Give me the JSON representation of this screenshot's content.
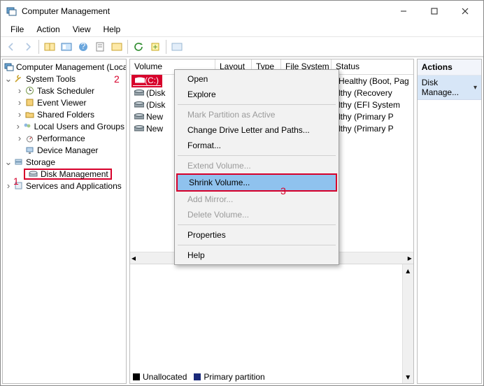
{
  "title": "Computer Management",
  "menubar": [
    "File",
    "Action",
    "View",
    "Help"
  ],
  "tree": {
    "root": "Computer Management (Local)",
    "systemTools": "System Tools",
    "children_st": [
      "Task Scheduler",
      "Event Viewer",
      "Shared Folders",
      "Local Users and Groups",
      "Performance",
      "Device Manager"
    ],
    "storage": "Storage",
    "diskMgmt": "Disk Management",
    "services": "Services and Applications"
  },
  "volumes": {
    "headers": {
      "vol": "Volume",
      "lay": "Layout",
      "ty": "Type",
      "fs": "File System",
      "st": "Status"
    },
    "rows": [
      {
        "label": "(C:)",
        "status": "Healthy (Boot, Pag",
        "selected": true
      },
      {
        "label": "(Disk",
        "status": "lthy (Recovery"
      },
      {
        "label": "(Disk",
        "status": "lthy (EFI System"
      },
      {
        "label": "New",
        "status": "lthy (Primary P"
      },
      {
        "label": "New",
        "status": "lthy (Primary P"
      }
    ]
  },
  "context": {
    "open": "Open",
    "explore": "Explore",
    "markActive": "Mark Partition as Active",
    "changeLetter": "Change Drive Letter and Paths...",
    "format": "Format...",
    "extend": "Extend Volume...",
    "shrink": "Shrink Volume...",
    "addMirror": "Add Mirror...",
    "deleteVol": "Delete Volume...",
    "properties": "Properties",
    "help": "Help"
  },
  "legend": {
    "unalloc": "Unallocated",
    "primary": "Primary partition"
  },
  "actions": {
    "header": "Actions",
    "item": "Disk Manage..."
  },
  "annotations": {
    "a1": "1",
    "a2": "2",
    "a3": "3"
  }
}
